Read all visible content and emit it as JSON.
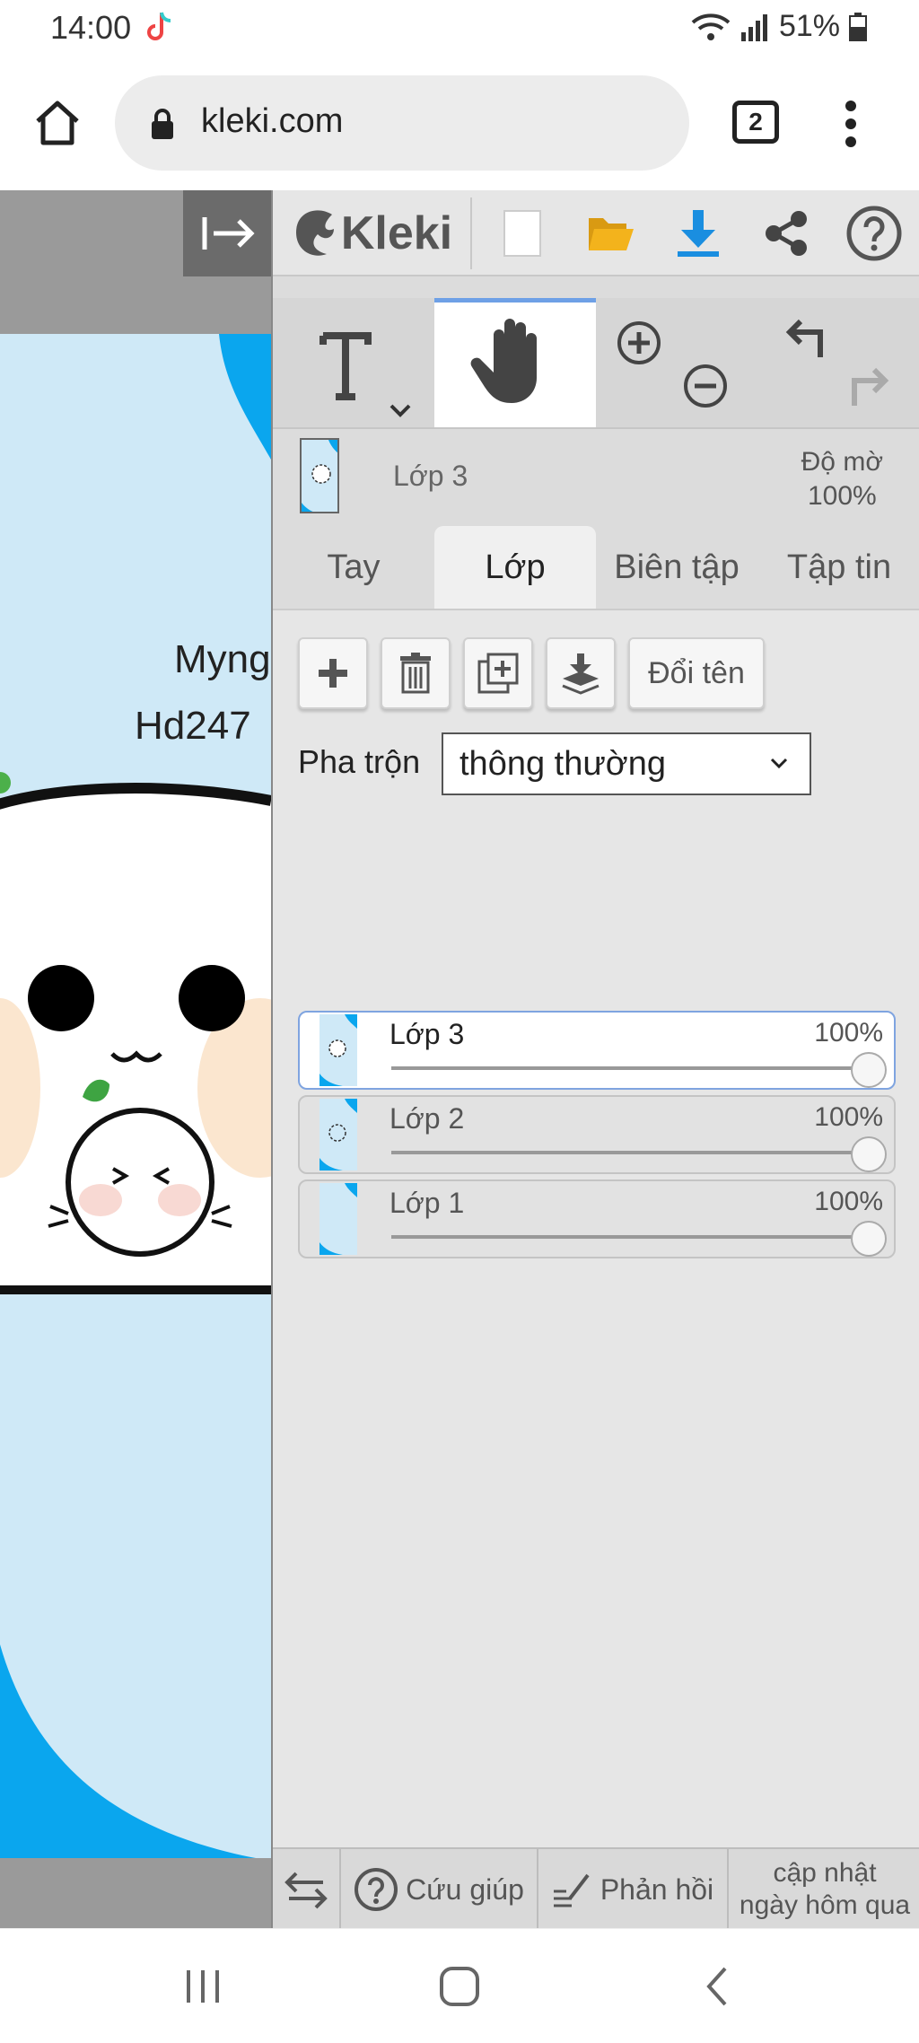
{
  "status_bar": {
    "time": "14:00",
    "battery": "51%"
  },
  "browser": {
    "url": "kleki.com",
    "tab_count": "2"
  },
  "canvas": {
    "doodle_text_1": "Myng",
    "doodle_text_2": "Hd247"
  },
  "app": {
    "logo_text": "Kleki",
    "layer_info": {
      "name": "Lớp 3",
      "opacity_label": "Độ mờ",
      "opacity_value": "100%"
    },
    "tabs": [
      {
        "label": "Tay"
      },
      {
        "label": "Lớp"
      },
      {
        "label": "Biên tập"
      },
      {
        "label": "Tập tin"
      }
    ],
    "rename_label": "Đổi tên",
    "blend": {
      "label": "Pha trộn",
      "value": "thông thường"
    },
    "layers": [
      {
        "name": "Lớp 3",
        "opacity": "100%",
        "active": true
      },
      {
        "name": "Lớp 2",
        "opacity": "100%",
        "active": false
      },
      {
        "name": "Lớp 1",
        "opacity": "100%",
        "active": false
      }
    ],
    "bottom": {
      "help": "Cứu giúp",
      "feedback": "Phản hồi",
      "updated_line1": "cập nhật",
      "updated_line2": "ngày hôm qua"
    }
  },
  "colors": {
    "accent_blue": "#1a8ee0",
    "sky": "#cfe9f7",
    "folder": "#f3b31c"
  }
}
